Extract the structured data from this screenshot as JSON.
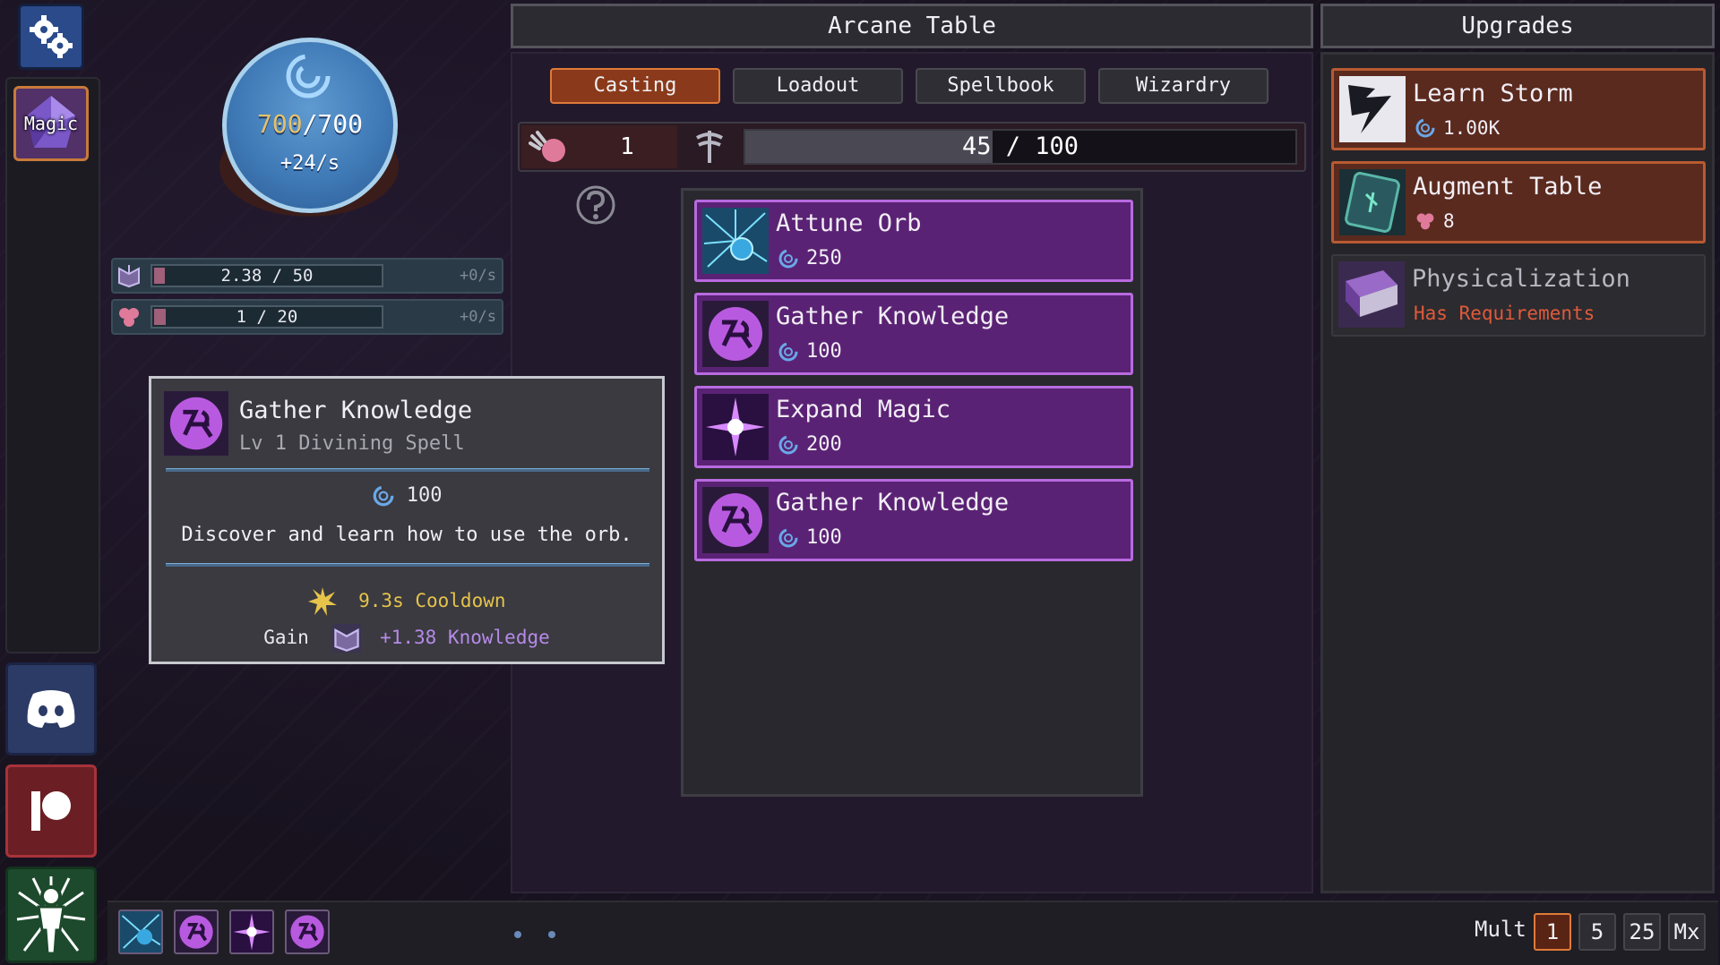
{
  "sidebar": {
    "magic_label": "Magic"
  },
  "orb": {
    "current": "700",
    "separator": "/",
    "max": "700",
    "rate": "+24/s"
  },
  "resources": [
    {
      "value": "2.38 / 50",
      "rate": "+0/s",
      "fill": 0.048,
      "icon": "knowledge-icon"
    },
    {
      "value": "1 / 20",
      "rate": "+0/s",
      "fill": 0.05,
      "icon": "gem-icon"
    }
  ],
  "tooltip": {
    "title": "Gather Knowledge",
    "subtitle": "Lv 1 Divining Spell",
    "cost": "100",
    "description": "Discover and learn how to use the orb.",
    "cooldown": "9.3s Cooldown",
    "gain_label": "Gain",
    "gain_value": "+1.38 Knowledge"
  },
  "center": {
    "title": "Arcane Table",
    "tabs": [
      {
        "label": "Casting",
        "active": true
      },
      {
        "label": "Loadout",
        "active": false
      },
      {
        "label": "Spellbook",
        "active": false
      },
      {
        "label": "Wizardry",
        "active": false
      }
    ],
    "cast_count": "1",
    "progress_text": "45 / 100",
    "progress": 0.45
  },
  "spells": [
    {
      "name": "Attune Orb",
      "cost": "250",
      "icon": "orb-icon"
    },
    {
      "name": "Gather Knowledge",
      "cost": "100",
      "icon": "rune-icon"
    },
    {
      "name": "Expand Magic",
      "cost": "200",
      "icon": "starburst-icon"
    },
    {
      "name": "Gather Knowledge",
      "cost": "100",
      "icon": "rune-icon"
    }
  ],
  "upgrades": {
    "title": "Upgrades",
    "items": [
      {
        "name": "Learn Storm",
        "cost": "1.00K",
        "cost_icon": "mana-icon",
        "icon": "storm-icon"
      },
      {
        "name": "Augment Table",
        "cost": "8",
        "cost_icon": "gem-icon",
        "icon": "tablet-icon"
      },
      {
        "name": "Physicalization",
        "requirement": "Has Requirements",
        "icon": "book-icon"
      }
    ]
  },
  "bottom": {
    "mult_label": "Mult",
    "mult_options": [
      "1",
      "5",
      "25",
      "Mx"
    ],
    "mult_active": "1"
  },
  "colors": {
    "accent": "#e07a3a",
    "spell_bg": "#5a2274",
    "spell_border": "#b86ae0",
    "mana": "#6aa8e8",
    "requirement": "#e05a3a",
    "cooldown": "#e6c34a",
    "knowledge": "#b68ae8"
  }
}
